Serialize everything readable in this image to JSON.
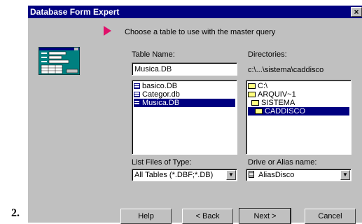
{
  "page_number": "2.",
  "dialog": {
    "title": "Database Form Expert",
    "close_glyph": "×",
    "instruction": "Choose a table to use with the master query",
    "table_name_label": "Table Name:",
    "table_name_value": "Musica.DB",
    "directories_label": "Directories:",
    "current_directory": "c:\\...\\sistema\\caddisco",
    "files": [
      "basico.DB",
      "Categor.db",
      "Musica.DB"
    ],
    "selected_file": "Musica.DB",
    "directories": [
      "C:\\",
      "ARQUIV~1",
      "SISTEMA",
      "CADDISCO"
    ],
    "selected_directory": "CADDISCO",
    "file_type_label": "List Files of Type:",
    "file_type_value": "All Tables (*.DBF;*.DB)",
    "drive_label": "Drive or Alias name:",
    "drive_value": "AliasDisco",
    "buttons": {
      "help": "Help",
      "back": "< Back",
      "next": "Next >",
      "cancel": "Cancel"
    },
    "colors": {
      "titlebar": "#000080",
      "dialog_bg": "#c0c0c0",
      "pointer": "#e0106a"
    }
  }
}
